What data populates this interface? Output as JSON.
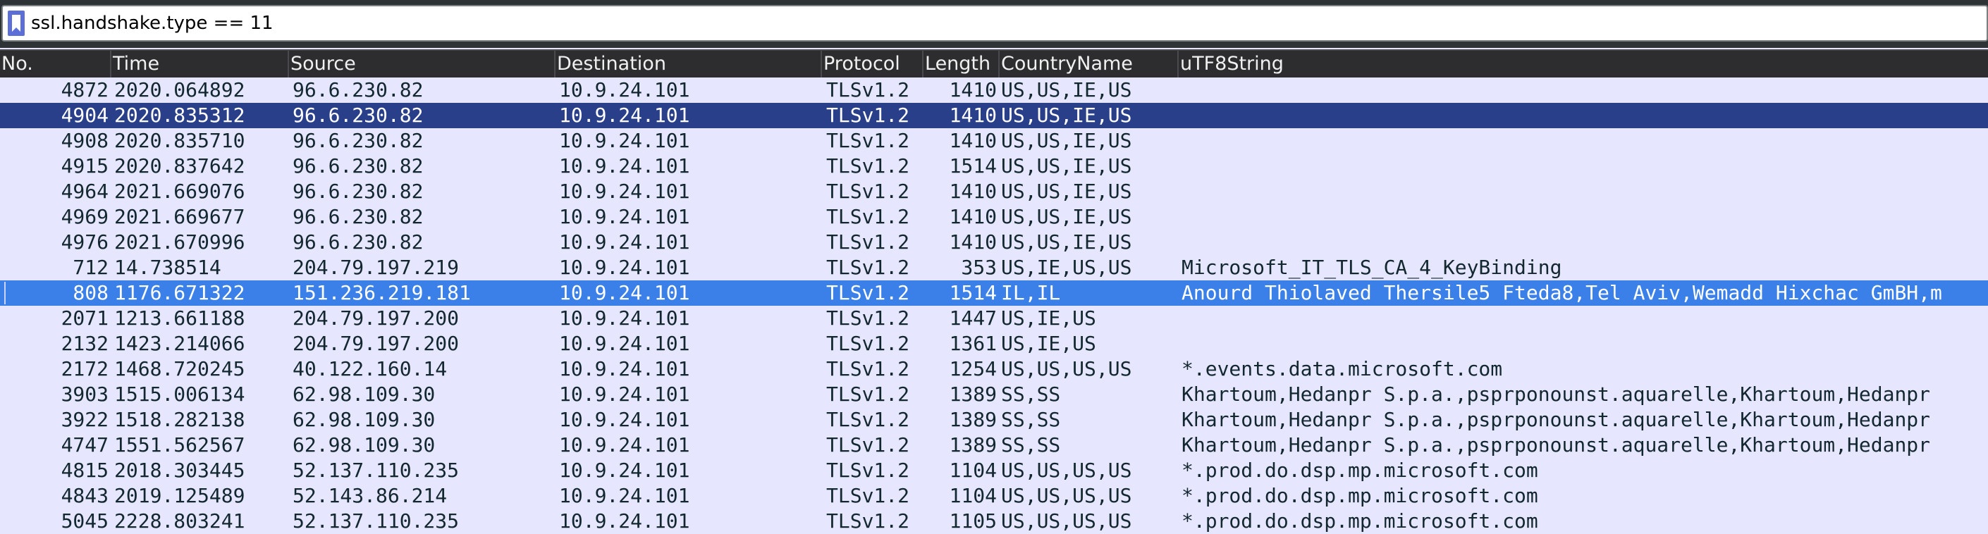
{
  "filter": {
    "expression": "ssl.handshake.type == 11",
    "bookmark_icon": "bookmark-icon"
  },
  "columns": [
    {
      "key": "no",
      "label": "No."
    },
    {
      "key": "time",
      "label": "Time"
    },
    {
      "key": "source",
      "label": "Source"
    },
    {
      "key": "destination",
      "label": "Destination"
    },
    {
      "key": "protocol",
      "label": "Protocol"
    },
    {
      "key": "length",
      "label": "Length"
    },
    {
      "key": "country",
      "label": "CountryName"
    },
    {
      "key": "utf8",
      "label": "uTF8String"
    }
  ],
  "colors": {
    "row_background": "#e7e6ff",
    "selected_dark": "#2a3f8a",
    "selected_bright": "#3a80e8",
    "header_background": "#2d2d30"
  },
  "rows": [
    {
      "no": "4872",
      "time": "2020.064892",
      "source": "96.6.230.82",
      "destination": "10.9.24.101",
      "protocol": "TLSv1.2",
      "length": "1410",
      "country": "US,US,IE,US",
      "utf8": "",
      "state": "normal"
    },
    {
      "no": "4904",
      "time": "2020.835312",
      "source": "96.6.230.82",
      "destination": "10.9.24.101",
      "protocol": "TLSv1.2",
      "length": "1410",
      "country": "US,US,IE,US",
      "utf8": "",
      "state": "sel-dark"
    },
    {
      "no": "4908",
      "time": "2020.835710",
      "source": "96.6.230.82",
      "destination": "10.9.24.101",
      "protocol": "TLSv1.2",
      "length": "1410",
      "country": "US,US,IE,US",
      "utf8": "",
      "state": "normal"
    },
    {
      "no": "4915",
      "time": "2020.837642",
      "source": "96.6.230.82",
      "destination": "10.9.24.101",
      "protocol": "TLSv1.2",
      "length": "1514",
      "country": "US,US,IE,US",
      "utf8": "",
      "state": "normal"
    },
    {
      "no": "4964",
      "time": "2021.669076",
      "source": "96.6.230.82",
      "destination": "10.9.24.101",
      "protocol": "TLSv1.2",
      "length": "1410",
      "country": "US,US,IE,US",
      "utf8": "",
      "state": "normal"
    },
    {
      "no": "4969",
      "time": "2021.669677",
      "source": "96.6.230.82",
      "destination": "10.9.24.101",
      "protocol": "TLSv1.2",
      "length": "1410",
      "country": "US,US,IE,US",
      "utf8": "",
      "state": "normal"
    },
    {
      "no": "4976",
      "time": "2021.670996",
      "source": "96.6.230.82",
      "destination": "10.9.24.101",
      "protocol": "TLSv1.2",
      "length": "1410",
      "country": "US,US,IE,US",
      "utf8": "",
      "state": "normal"
    },
    {
      "no": "712",
      "time": "14.738514",
      "source": "204.79.197.219",
      "destination": "10.9.24.101",
      "protocol": "TLSv1.2",
      "length": "353",
      "country": "US,IE,US,US",
      "utf8": "Microsoft_IT_TLS_CA_4_KeyBinding",
      "state": "normal"
    },
    {
      "no": "808",
      "time": "1176.671322",
      "source": "151.236.219.181",
      "destination": "10.9.24.101",
      "protocol": "TLSv1.2",
      "length": "1514",
      "country": "IL,IL",
      "utf8": "Anourd Thiolaved Thersile5 Fteda8,Tel Aviv,Wemadd Hixchac GmBH,m",
      "state": "sel-bright"
    },
    {
      "no": "2071",
      "time": "1213.661188",
      "source": "204.79.197.200",
      "destination": "10.9.24.101",
      "protocol": "TLSv1.2",
      "length": "1447",
      "country": "US,IE,US",
      "utf8": "",
      "state": "normal"
    },
    {
      "no": "2132",
      "time": "1423.214066",
      "source": "204.79.197.200",
      "destination": "10.9.24.101",
      "protocol": "TLSv1.2",
      "length": "1361",
      "country": "US,IE,US",
      "utf8": "",
      "state": "normal"
    },
    {
      "no": "2172",
      "time": "1468.720245",
      "source": "40.122.160.14",
      "destination": "10.9.24.101",
      "protocol": "TLSv1.2",
      "length": "1254",
      "country": "US,US,US,US",
      "utf8": "*.events.data.microsoft.com",
      "state": "normal"
    },
    {
      "no": "3903",
      "time": "1515.006134",
      "source": "62.98.109.30",
      "destination": "10.9.24.101",
      "protocol": "TLSv1.2",
      "length": "1389",
      "country": "SS,SS",
      "utf8": "Khartoum,Hedanpr S.p.a.,psprponounst.aquarelle,Khartoum,Hedanpr",
      "state": "normal"
    },
    {
      "no": "3922",
      "time": "1518.282138",
      "source": "62.98.109.30",
      "destination": "10.9.24.101",
      "protocol": "TLSv1.2",
      "length": "1389",
      "country": "SS,SS",
      "utf8": "Khartoum,Hedanpr S.p.a.,psprponounst.aquarelle,Khartoum,Hedanpr",
      "state": "normal"
    },
    {
      "no": "4747",
      "time": "1551.562567",
      "source": "62.98.109.30",
      "destination": "10.9.24.101",
      "protocol": "TLSv1.2",
      "length": "1389",
      "country": "SS,SS",
      "utf8": "Khartoum,Hedanpr S.p.a.,psprponounst.aquarelle,Khartoum,Hedanpr",
      "state": "normal"
    },
    {
      "no": "4815",
      "time": "2018.303445",
      "source": "52.137.110.235",
      "destination": "10.9.24.101",
      "protocol": "TLSv1.2",
      "length": "1104",
      "country": "US,US,US,US",
      "utf8": "*.prod.do.dsp.mp.microsoft.com",
      "state": "normal"
    },
    {
      "no": "4843",
      "time": "2019.125489",
      "source": "52.143.86.214",
      "destination": "10.9.24.101",
      "protocol": "TLSv1.2",
      "length": "1104",
      "country": "US,US,US,US",
      "utf8": "*.prod.do.dsp.mp.microsoft.com",
      "state": "normal"
    },
    {
      "no": "5045",
      "time": "2228.803241",
      "source": "52.137.110.235",
      "destination": "10.9.24.101",
      "protocol": "TLSv1.2",
      "length": "1105",
      "country": "US,US,US,US",
      "utf8": "*.prod.do.dsp.mp.microsoft.com",
      "state": "normal"
    }
  ]
}
